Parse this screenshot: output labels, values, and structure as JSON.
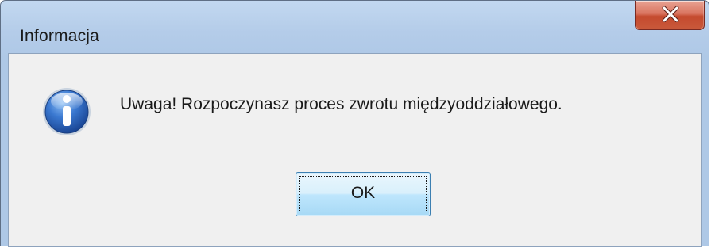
{
  "window": {
    "title": "Informacja",
    "close_glyph": "X"
  },
  "dialog": {
    "icon": "info-icon",
    "message": "Uwaga! Rozpoczynasz proces zwrotu międzyoddziałowego.",
    "ok_label": "OK"
  },
  "colors": {
    "title_bar": "#b4cce9",
    "close_button": "#c44a2e",
    "client_background": "#f0f0f0",
    "ok_button_border": "#3c7fb1",
    "info_icon": "#2a5db0"
  }
}
